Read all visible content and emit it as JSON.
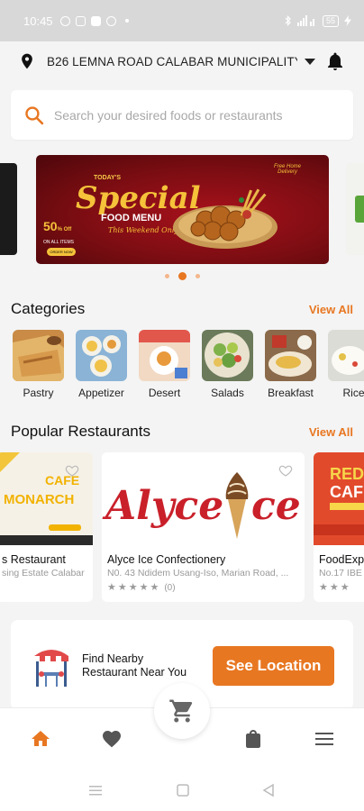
{
  "status_bar": {
    "time": "10:45",
    "battery": "55"
  },
  "location": {
    "address": "B26 LEMNA ROAD CALABAR MUNICIPALITY ..."
  },
  "search": {
    "placeholder": "Search your desired foods or restaurants"
  },
  "banner": {
    "todays": "TODAY'S",
    "special": "Special",
    "food_menu": "FOOD MENU",
    "weekend": "This Weekend Only",
    "discount": "50",
    "discount_suffix": "% Off",
    "discount_note": "ON ALL ITEMS",
    "order_label": "ORDER NOW",
    "free_delivery": "Free Home Delivery"
  },
  "carousel": {
    "slide_count": 3,
    "active_index": 1,
    "accent": "#e87722"
  },
  "categories_section": {
    "title": "Categories",
    "view_all": "View All",
    "items": [
      {
        "label": "Pastry"
      },
      {
        "label": "Appetizer"
      },
      {
        "label": "Desert"
      },
      {
        "label": "Salads"
      },
      {
        "label": "Breakfast"
      },
      {
        "label": "Rice"
      }
    ]
  },
  "restaurants_section": {
    "title": "Popular Restaurants",
    "view_all": "View All",
    "items": [
      {
        "name": "s Restaurant",
        "address": "sing Estate Calabar",
        "rating_count": "",
        "cover_text": "CAFÉ MONARCH"
      },
      {
        "name": "Alyce Ice Confectionery",
        "address": "N0. 43 Ndidem Usang-Iso, Marian Road, ...",
        "rating_count": "(0)",
        "cover_text": "Alyce Ice"
      },
      {
        "name": "FoodExp",
        "address": "No.17 IBE",
        "rating_count": "",
        "cover_text": "RED CAFE"
      }
    ]
  },
  "nearby": {
    "line1": "Find Nearby",
    "line2": "Restaurant Near You",
    "button": "See Location"
  },
  "colors": {
    "accent": "#e87722",
    "background": "#f4f4f4"
  },
  "nav": {
    "icons": [
      "home-icon",
      "heart-icon",
      "cart-icon",
      "shopping-bag-icon",
      "menu-icon"
    ]
  }
}
